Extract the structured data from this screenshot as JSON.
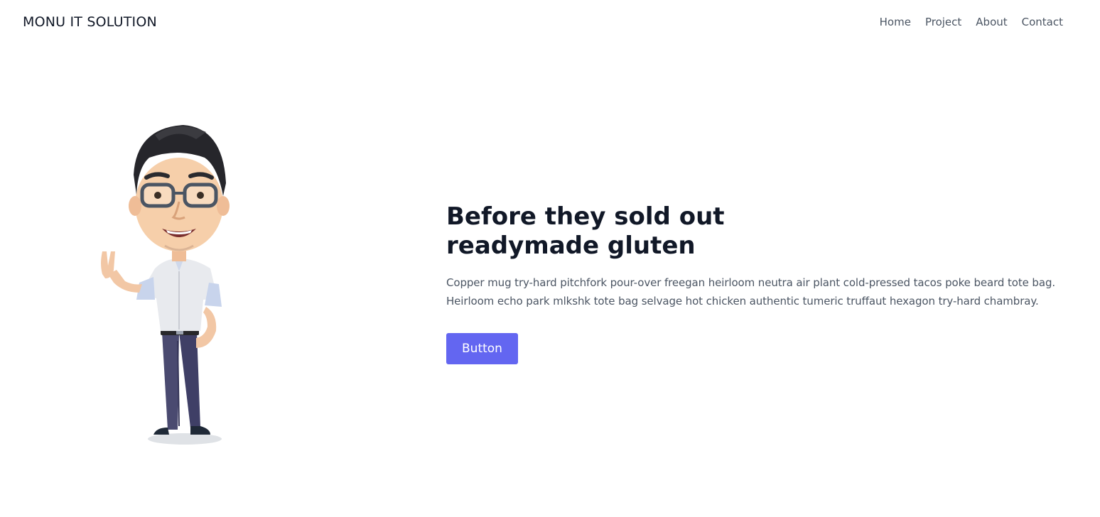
{
  "header": {
    "brand": "MONU IT SOLUTION",
    "nav": [
      "Home",
      "Project",
      "About",
      "Contact"
    ]
  },
  "hero": {
    "image": "cartoon-man-with-glasses-peace-sign",
    "title_line1": "Before they sold out",
    "title_line2": "readymade gluten",
    "paragraph_line1": "Copper mug try-hard pitchfork pour-over freegan heirloom neutra air plant cold-pressed tacos poke beard tote bag.",
    "paragraph_line2": "Heirloom echo park mlkshk tote bag selvage hot chicken authentic tumeric truffaut hexagon try-hard chambray.",
    "button_label": "Button"
  },
  "colors": {
    "accent": "#6366f1",
    "heading": "#111827",
    "body_text": "#4b5563"
  }
}
